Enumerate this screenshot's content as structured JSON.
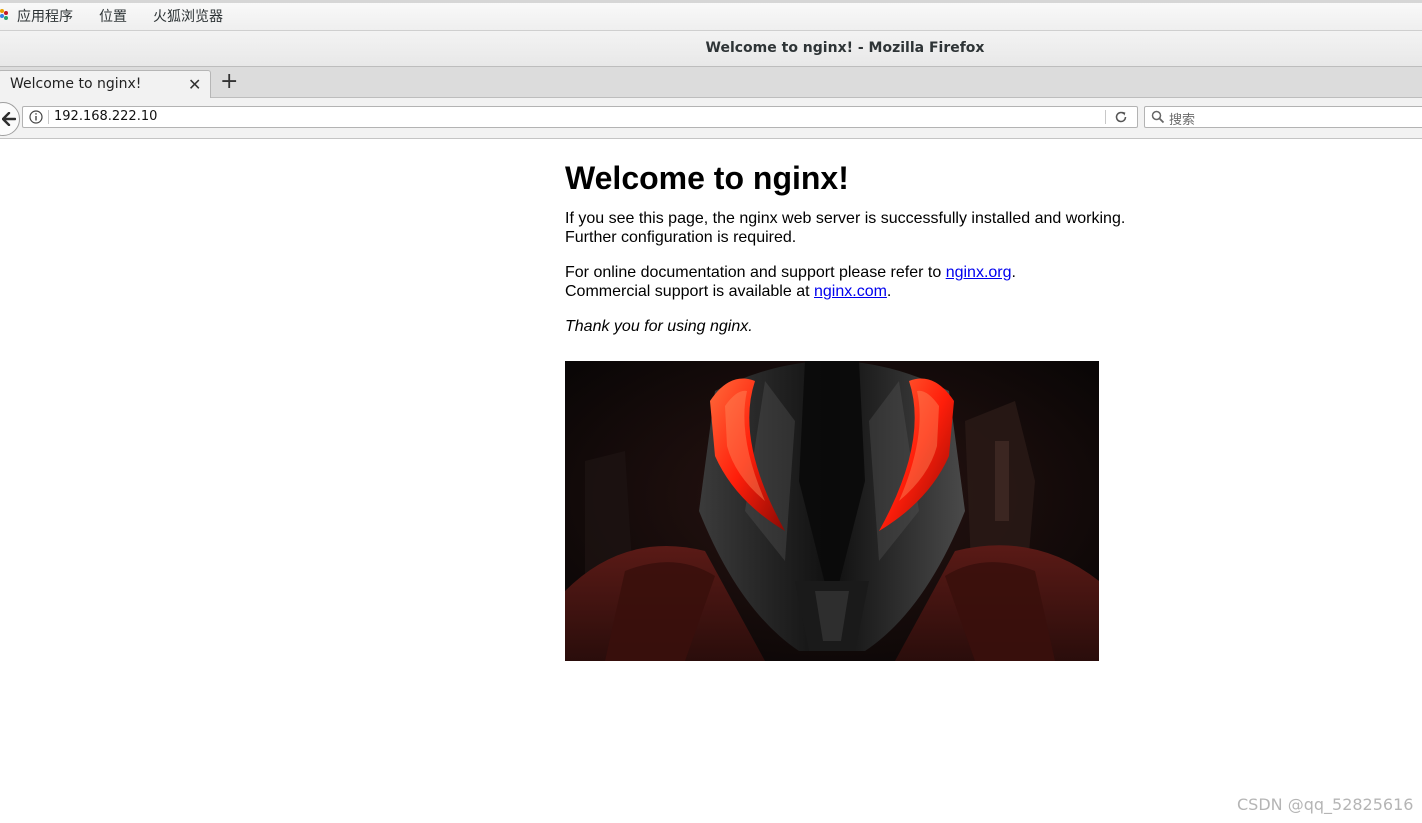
{
  "desktop": {
    "menu": {
      "applications": "应用程序",
      "places": "位置",
      "firefox": "火狐浏览器"
    }
  },
  "window": {
    "title": "Welcome to nginx! - Mozilla Firefox"
  },
  "browser": {
    "tab": {
      "label": "Welcome to nginx!",
      "close_glyph": "✕"
    },
    "new_tab_glyph": "+",
    "url": "192.168.222.10",
    "search_placeholder": "搜索"
  },
  "page": {
    "heading": "Welcome to nginx!",
    "para1_line1": "If you see this page, the nginx web server is successfully installed and working.",
    "para1_line2": "Further configuration is required.",
    "para2_prefix": "For online documentation and support please refer to ",
    "org_link": "nginx.org",
    "para2_suffix": ".",
    "para3_prefix": "Commercial support is available at ",
    "com_link": "nginx.com",
    "para3_suffix": ".",
    "thanks": "Thank you for using nginx.",
    "image": {
      "subject": "dark armored character with glowing red eyes",
      "colors": {
        "eyes": "#ff2a10",
        "armor": "#1c1c1c",
        "background": "#0d0a0a",
        "accent_red": "#6e1a14"
      }
    }
  },
  "watermark": "CSDN @qq_52825616",
  "colors": {
    "link": "#0000ee",
    "topbar_bg": "#f4f4f4",
    "titlebar_bg": "#ececec"
  }
}
